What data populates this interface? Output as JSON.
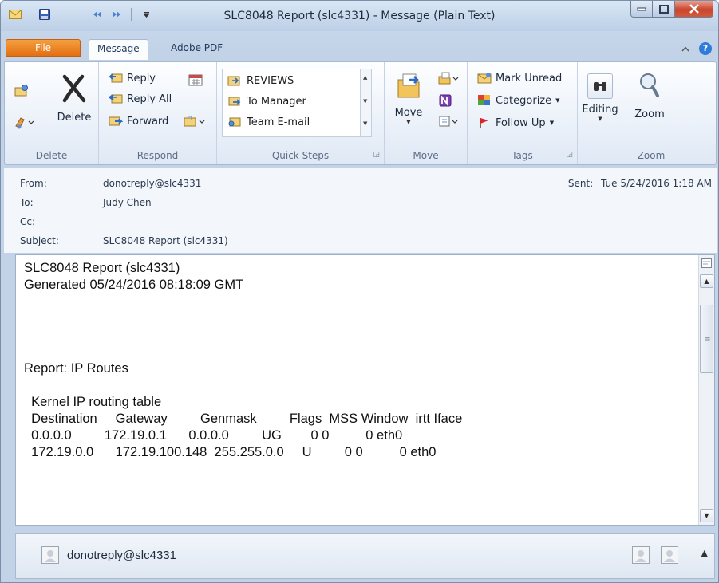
{
  "window": {
    "title": "SLC8048 Report (slc4331) - Message (Plain Text)"
  },
  "tabs": {
    "file": "File",
    "message": "Message",
    "adobe": "Adobe PDF"
  },
  "ribbon": {
    "delete_group": {
      "label": "Delete",
      "delete_button": "Delete"
    },
    "respond_group": {
      "label": "Respond",
      "reply": "Reply",
      "reply_all": "Reply All",
      "forward": "Forward"
    },
    "quick_steps_group": {
      "label": "Quick Steps",
      "items": [
        "REVIEWS",
        "To Manager",
        "Team E-mail"
      ]
    },
    "move_group": {
      "label": "Move",
      "move_button": "Move"
    },
    "tags_group": {
      "label": "Tags",
      "mark_unread": "Mark Unread",
      "categorize": "Categorize",
      "follow_up": "Follow Up"
    },
    "editing_group": {
      "editing_button": "Editing"
    },
    "zoom_group": {
      "label": "Zoom",
      "zoom_button": "Zoom"
    }
  },
  "headers": {
    "from_label": "From:",
    "from_value": "donotreply@slc4331",
    "to_label": "To:",
    "to_value": "Judy Chen",
    "cc_label": "Cc:",
    "cc_value": "",
    "subject_label": "Subject:",
    "subject_value": "SLC8048 Report (slc4331)",
    "sent_label": "Sent:",
    "sent_value": "Tue 5/24/2016 1:18 AM"
  },
  "body": {
    "lines": [
      "SLC8048 Report (slc4331)",
      "Generated 05/24/2016 08:18:09 GMT",
      "",
      "",
      "",
      "",
      "Report: IP Routes",
      "",
      "  Kernel IP routing table",
      "  Destination     Gateway         Genmask         Flags  MSS Window  irtt Iface",
      "  0.0.0.0         172.19.0.1      0.0.0.0         UG        0 0          0 eth0",
      "  172.19.0.0      172.19.100.148  255.255.0.0     U         0 0          0 eth0"
    ]
  },
  "people_pane": {
    "name": "donotreply@slc4331"
  },
  "colors": {
    "file_tab": "#e36f12",
    "close_button": "#c9452b",
    "frame": "#c2d3e8"
  }
}
